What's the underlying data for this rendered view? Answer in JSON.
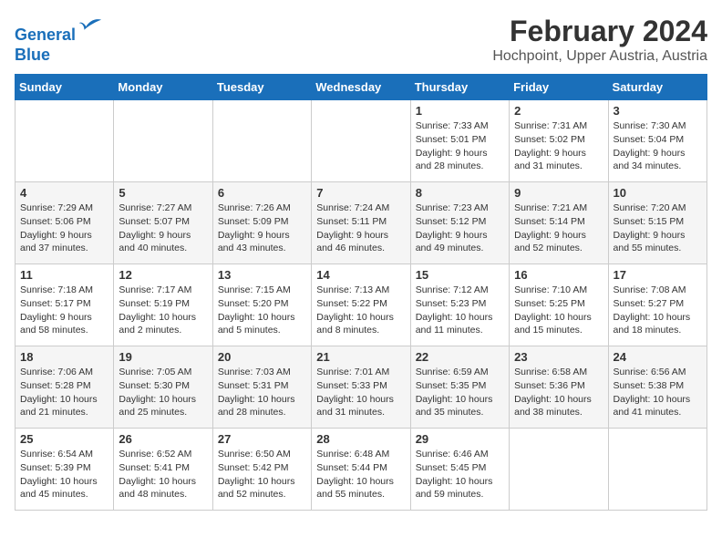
{
  "header": {
    "logo_line1": "General",
    "logo_line2": "Blue",
    "title": "February 2024",
    "subtitle": "Hochpoint, Upper Austria, Austria"
  },
  "weekdays": [
    "Sunday",
    "Monday",
    "Tuesday",
    "Wednesday",
    "Thursday",
    "Friday",
    "Saturday"
  ],
  "weeks": [
    [
      {
        "day": "",
        "info": ""
      },
      {
        "day": "",
        "info": ""
      },
      {
        "day": "",
        "info": ""
      },
      {
        "day": "",
        "info": ""
      },
      {
        "day": "1",
        "info": "Sunrise: 7:33 AM\nSunset: 5:01 PM\nDaylight: 9 hours and 28 minutes."
      },
      {
        "day": "2",
        "info": "Sunrise: 7:31 AM\nSunset: 5:02 PM\nDaylight: 9 hours and 31 minutes."
      },
      {
        "day": "3",
        "info": "Sunrise: 7:30 AM\nSunset: 5:04 PM\nDaylight: 9 hours and 34 minutes."
      }
    ],
    [
      {
        "day": "4",
        "info": "Sunrise: 7:29 AM\nSunset: 5:06 PM\nDaylight: 9 hours and 37 minutes."
      },
      {
        "day": "5",
        "info": "Sunrise: 7:27 AM\nSunset: 5:07 PM\nDaylight: 9 hours and 40 minutes."
      },
      {
        "day": "6",
        "info": "Sunrise: 7:26 AM\nSunset: 5:09 PM\nDaylight: 9 hours and 43 minutes."
      },
      {
        "day": "7",
        "info": "Sunrise: 7:24 AM\nSunset: 5:11 PM\nDaylight: 9 hours and 46 minutes."
      },
      {
        "day": "8",
        "info": "Sunrise: 7:23 AM\nSunset: 5:12 PM\nDaylight: 9 hours and 49 minutes."
      },
      {
        "day": "9",
        "info": "Sunrise: 7:21 AM\nSunset: 5:14 PM\nDaylight: 9 hours and 52 minutes."
      },
      {
        "day": "10",
        "info": "Sunrise: 7:20 AM\nSunset: 5:15 PM\nDaylight: 9 hours and 55 minutes."
      }
    ],
    [
      {
        "day": "11",
        "info": "Sunrise: 7:18 AM\nSunset: 5:17 PM\nDaylight: 9 hours and 58 minutes."
      },
      {
        "day": "12",
        "info": "Sunrise: 7:17 AM\nSunset: 5:19 PM\nDaylight: 10 hours and 2 minutes."
      },
      {
        "day": "13",
        "info": "Sunrise: 7:15 AM\nSunset: 5:20 PM\nDaylight: 10 hours and 5 minutes."
      },
      {
        "day": "14",
        "info": "Sunrise: 7:13 AM\nSunset: 5:22 PM\nDaylight: 10 hours and 8 minutes."
      },
      {
        "day": "15",
        "info": "Sunrise: 7:12 AM\nSunset: 5:23 PM\nDaylight: 10 hours and 11 minutes."
      },
      {
        "day": "16",
        "info": "Sunrise: 7:10 AM\nSunset: 5:25 PM\nDaylight: 10 hours and 15 minutes."
      },
      {
        "day": "17",
        "info": "Sunrise: 7:08 AM\nSunset: 5:27 PM\nDaylight: 10 hours and 18 minutes."
      }
    ],
    [
      {
        "day": "18",
        "info": "Sunrise: 7:06 AM\nSunset: 5:28 PM\nDaylight: 10 hours and 21 minutes."
      },
      {
        "day": "19",
        "info": "Sunrise: 7:05 AM\nSunset: 5:30 PM\nDaylight: 10 hours and 25 minutes."
      },
      {
        "day": "20",
        "info": "Sunrise: 7:03 AM\nSunset: 5:31 PM\nDaylight: 10 hours and 28 minutes."
      },
      {
        "day": "21",
        "info": "Sunrise: 7:01 AM\nSunset: 5:33 PM\nDaylight: 10 hours and 31 minutes."
      },
      {
        "day": "22",
        "info": "Sunrise: 6:59 AM\nSunset: 5:35 PM\nDaylight: 10 hours and 35 minutes."
      },
      {
        "day": "23",
        "info": "Sunrise: 6:58 AM\nSunset: 5:36 PM\nDaylight: 10 hours and 38 minutes."
      },
      {
        "day": "24",
        "info": "Sunrise: 6:56 AM\nSunset: 5:38 PM\nDaylight: 10 hours and 41 minutes."
      }
    ],
    [
      {
        "day": "25",
        "info": "Sunrise: 6:54 AM\nSunset: 5:39 PM\nDaylight: 10 hours and 45 minutes."
      },
      {
        "day": "26",
        "info": "Sunrise: 6:52 AM\nSunset: 5:41 PM\nDaylight: 10 hours and 48 minutes."
      },
      {
        "day": "27",
        "info": "Sunrise: 6:50 AM\nSunset: 5:42 PM\nDaylight: 10 hours and 52 minutes."
      },
      {
        "day": "28",
        "info": "Sunrise: 6:48 AM\nSunset: 5:44 PM\nDaylight: 10 hours and 55 minutes."
      },
      {
        "day": "29",
        "info": "Sunrise: 6:46 AM\nSunset: 5:45 PM\nDaylight: 10 hours and 59 minutes."
      },
      {
        "day": "",
        "info": ""
      },
      {
        "day": "",
        "info": ""
      }
    ]
  ]
}
